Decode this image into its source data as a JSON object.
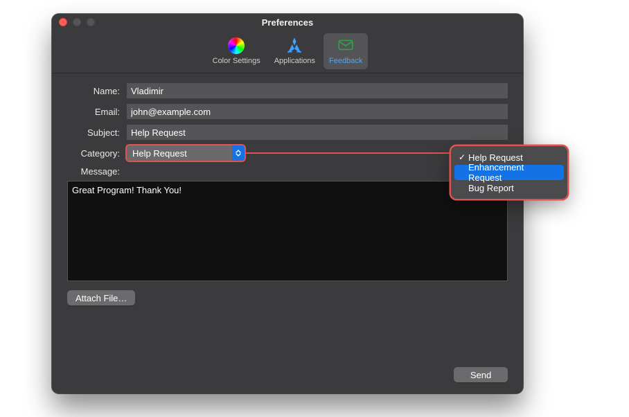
{
  "window": {
    "title": "Preferences"
  },
  "toolbar": {
    "items": [
      {
        "label": "Color Settings"
      },
      {
        "label": "Applications"
      },
      {
        "label": "Feedback"
      }
    ]
  },
  "form": {
    "name_label": "Name:",
    "name_value": "Vladimir",
    "email_label": "Email:",
    "email_value": "john@example.com",
    "subject_label": "Subject:",
    "subject_value": "Help Request",
    "category_label": "Category:",
    "category_value": "Help Request",
    "message_label": "Message:",
    "message_value": "Great Program! Thank You!",
    "attach_label": "Attach File…",
    "send_label": "Send"
  },
  "popup": {
    "items": [
      {
        "label": "Help Request",
        "checked": true,
        "selected": false
      },
      {
        "label": "Enhancement Request",
        "checked": false,
        "selected": true
      },
      {
        "label": "Bug Report",
        "checked": false,
        "selected": false
      }
    ]
  },
  "colors": {
    "callout_red": "#e0524f",
    "accent_blue": "#1373e6"
  }
}
